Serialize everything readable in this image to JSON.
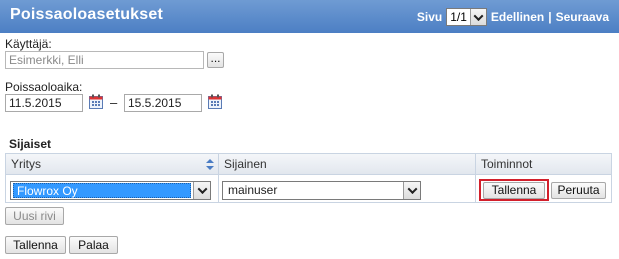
{
  "header": {
    "title": "Poissaoloasetukset",
    "page_label": "Sivu",
    "page_value": "1/1",
    "prev_link": "Edellinen",
    "separator": "|",
    "next_link": "Seuraava",
    "bg_color": "#5b8bcb"
  },
  "user": {
    "label": "Käyttäjä:",
    "value": "Esimerkki, Elli",
    "browse_label": "..."
  },
  "absence": {
    "label": "Poissaoloaika:",
    "start": "11.5.2015",
    "dash": "–",
    "end": "15.5.2015",
    "calendar_icon": "calendar-icon"
  },
  "substitutes": {
    "title": "Sijaiset",
    "columns": [
      "Yritys",
      "Sijainen",
      "Toiminnot"
    ],
    "row": {
      "company": "Flowrox Oy",
      "substitute": "mainuser",
      "save_label": "Tallenna",
      "cancel_label": "Peruuta"
    },
    "new_row_label": "Uusi rivi",
    "highlight_color": "#d21f2b"
  },
  "footer": {
    "save_label": "Tallenna",
    "back_label": "Palaa"
  }
}
